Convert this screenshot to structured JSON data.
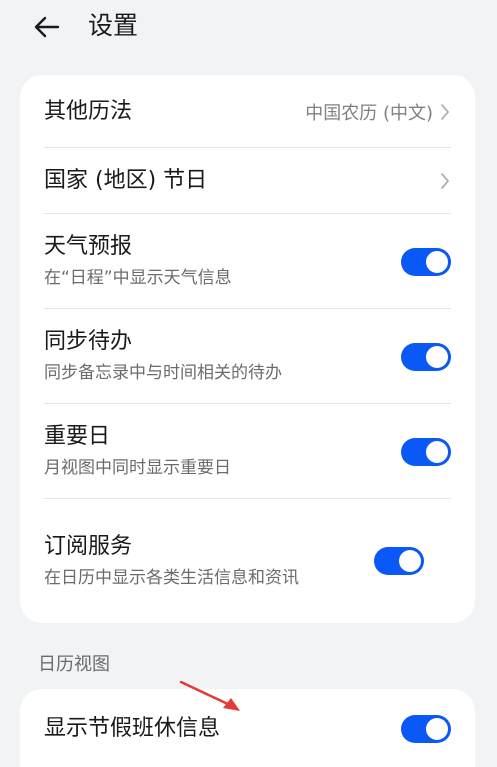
{
  "header": {
    "title": "设置",
    "back_icon": "arrow-left-icon"
  },
  "settings": {
    "other_calendar": {
      "label": "其他历法",
      "value": "中国农历 (中文)"
    },
    "holidays": {
      "label": "国家 (地区) 节日"
    },
    "weather": {
      "label": "天气预报",
      "desc": "在“日程”中显示天气信息",
      "enabled": true
    },
    "sync_todo": {
      "label": "同步待办",
      "desc": "同步备忘录中与时间相关的待办",
      "enabled": true
    },
    "important_day": {
      "label": "重要日",
      "desc": "月视图中同时显示重要日",
      "enabled": true
    },
    "subscription": {
      "label": "订阅服务",
      "desc": "在日历中显示各类生活信息和资讯",
      "enabled": true
    }
  },
  "calendar_view": {
    "section_label": "日历视图",
    "show_holiday_info": {
      "label": "显示节假班休信息",
      "enabled": true
    }
  },
  "colors": {
    "accent": "#0a59f7",
    "arrow": "#e53935",
    "background": "#f1f3f5"
  }
}
